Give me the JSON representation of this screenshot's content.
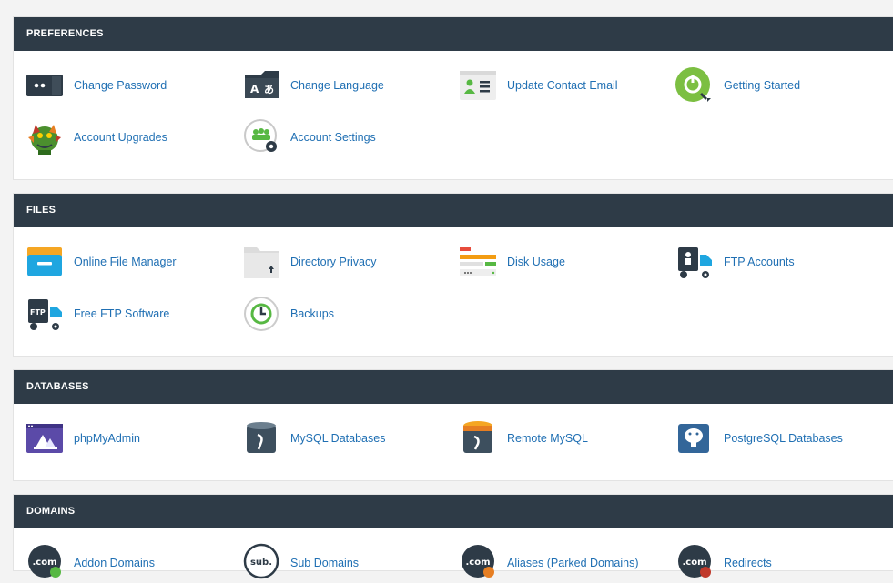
{
  "colors": {
    "header_bg": "#2e3b47",
    "header_text": "#ffffff",
    "link": "#1f6fb3",
    "panel_bg": "#ffffff",
    "page_bg": "#f3f3f3"
  },
  "sections": {
    "preferences": {
      "title": "PREFERENCES",
      "items": [
        {
          "label": "Change Password",
          "icon": "password-icon"
        },
        {
          "label": "Change Language",
          "icon": "language-icon"
        },
        {
          "label": "Update Contact Email",
          "icon": "contact-email-icon"
        },
        {
          "label": "Getting Started",
          "icon": "getting-started-icon"
        },
        {
          "label": "Account Upgrades",
          "icon": "account-upgrades-icon"
        },
        {
          "label": "Account Settings",
          "icon": "account-settings-icon"
        }
      ]
    },
    "files": {
      "title": "FILES",
      "items": [
        {
          "label": "Online File Manager",
          "icon": "file-manager-icon"
        },
        {
          "label": "Directory Privacy",
          "icon": "directory-privacy-icon"
        },
        {
          "label": "Disk Usage",
          "icon": "disk-usage-icon"
        },
        {
          "label": "FTP Accounts",
          "icon": "ftp-accounts-icon"
        },
        {
          "label": "Free FTP Software",
          "icon": "free-ftp-icon"
        },
        {
          "label": "Backups",
          "icon": "backups-icon"
        }
      ]
    },
    "databases": {
      "title": "DATABASES",
      "items": [
        {
          "label": "phpMyAdmin",
          "icon": "phpmyadmin-icon"
        },
        {
          "label": "MySQL Databases",
          "icon": "mysql-icon"
        },
        {
          "label": "Remote MySQL",
          "icon": "remote-mysql-icon"
        },
        {
          "label": "PostgreSQL Databases",
          "icon": "postgresql-icon"
        }
      ]
    },
    "domains": {
      "title": "DOMAINS",
      "items": [
        {
          "label": "Addon Domains",
          "icon": "addon-domains-icon",
          "badge": ".com"
        },
        {
          "label": "Sub Domains",
          "icon": "sub-domains-icon",
          "badge": "sub."
        },
        {
          "label": "Aliases (Parked Domains)",
          "icon": "aliases-icon",
          "badge": ".com"
        },
        {
          "label": "Redirects",
          "icon": "redirects-icon",
          "badge": ".com"
        }
      ]
    }
  }
}
